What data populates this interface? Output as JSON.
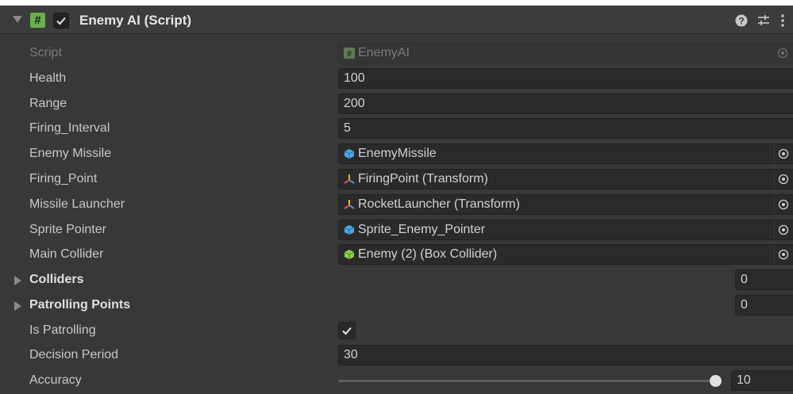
{
  "header": {
    "title": "Enemy AI (Script)",
    "enabled": true,
    "script_icon_glyph": "#",
    "icons": [
      "help-icon",
      "preset-icon",
      "more-menu-icon"
    ]
  },
  "fields": {
    "script": {
      "label": "Script",
      "value": "EnemyAI",
      "icon": "script-icon"
    },
    "health": {
      "label": "Health",
      "value": "100"
    },
    "range": {
      "label": "Range",
      "value": "200"
    },
    "firing_interval": {
      "label": "Firing_Interval",
      "value": "5"
    },
    "enemy_missile": {
      "label": "Enemy Missile",
      "value": "EnemyMissile",
      "icon": "prefab-icon"
    },
    "firing_point": {
      "label": "Firing_Point",
      "value": "FiringPoint (Transform)",
      "icon": "transform-icon"
    },
    "missile_launcher": {
      "label": "Missile Launcher",
      "value": "RocketLauncher (Transform)",
      "icon": "transform-icon"
    },
    "sprite_pointer": {
      "label": "Sprite Pointer",
      "value": "Sprite_Enemy_Pointer",
      "icon": "prefab-icon"
    },
    "main_collider": {
      "label": "Main Collider",
      "value": "Enemy (2) (Box Collider)",
      "icon": "box-collider-icon"
    },
    "colliders": {
      "label": "Colliders",
      "count": "0"
    },
    "patrolling_points": {
      "label": "Patrolling Points",
      "count": "0"
    },
    "is_patrolling": {
      "label": "Is Patrolling",
      "checked": true
    },
    "decision_period": {
      "label": "Decision Period",
      "value": "30"
    },
    "accuracy": {
      "label": "Accuracy",
      "value": "10",
      "slider_fraction": 1.0
    }
  },
  "colors": {
    "background": "#383838",
    "field": "#2a2a2a",
    "script_green": "#6ab04c",
    "prefab_blue": "#4aa8e8",
    "collider_green": "#8bd14b"
  }
}
